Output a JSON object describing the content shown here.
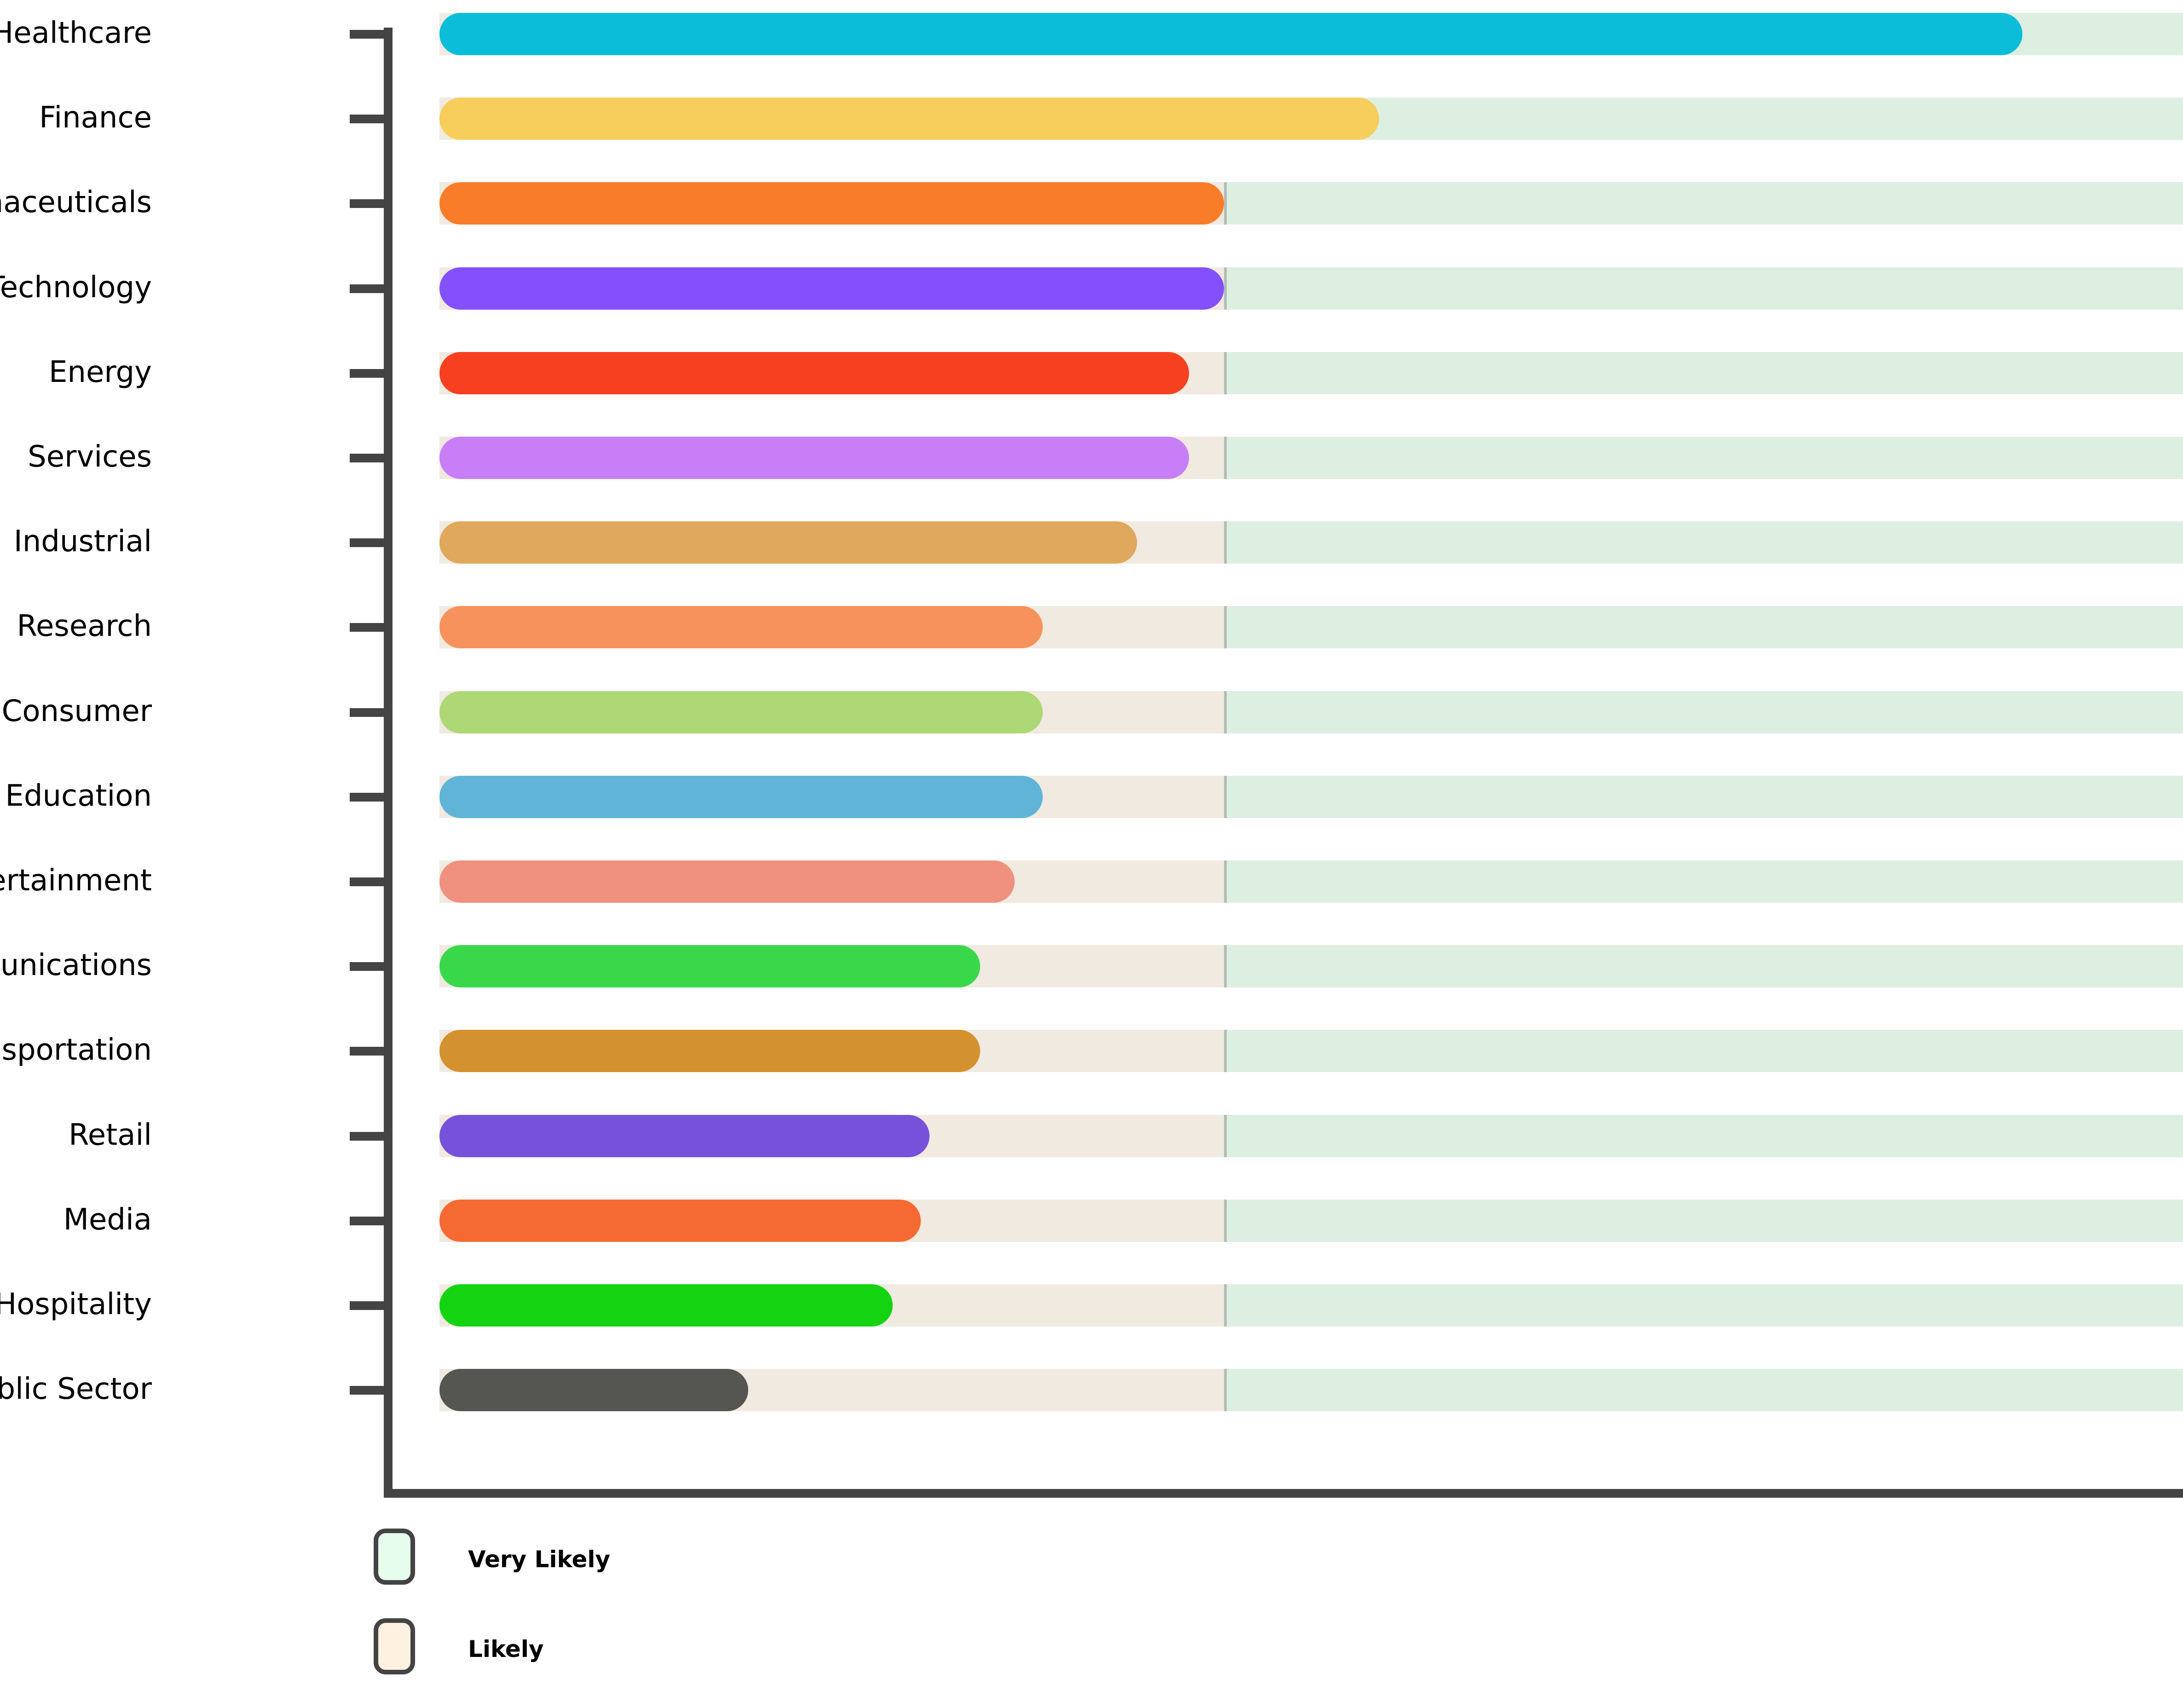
{
  "chart_data": {
    "type": "bar",
    "orientation": "horizontal",
    "title": "",
    "xlabel": "",
    "ylabel": "",
    "grid": false,
    "legend_position": "bottom-left",
    "axis_color": "#444444",
    "xlim": [
      0,
      100
    ],
    "zone_boundary": 45,
    "categories": [
      "Healthcare",
      "Finance",
      "Pharmaceuticals",
      "Technology",
      "Energy",
      "Services",
      "Industrial",
      "Research",
      "Consumer",
      "Education",
      "Entertainment",
      "Communications",
      "Transportation",
      "Retail",
      "Media",
      "Hospitality",
      "Public Sector"
    ],
    "values": [
      90.8,
      53.9,
      45.0,
      45.0,
      43.0,
      43.0,
      40.0,
      34.6,
      34.6,
      34.6,
      33.0,
      31.0,
      31.0,
      28.1,
      27.6,
      26.0,
      17.7
    ],
    "bar_colors": [
      "#0bbdd9",
      "#f7cd5c",
      "#f97d28",
      "#8450fb",
      "#f7401f",
      "#c87ef7",
      "#dfa85c",
      "#f8925c",
      "#aed775",
      "#60b4d8",
      "#f0907e",
      "#39d84a",
      "#d4912f",
      "#7552d9",
      "#f56a32",
      "#14d412",
      "#555552"
    ],
    "zones": [
      {
        "name": "Very Likely",
        "fill": "#e6fcec",
        "fill_alt": "#ddefe1"
      },
      {
        "name": "Likely",
        "fill": "#fdf1e0",
        "fill_alt": "#f0eae0"
      }
    ]
  },
  "legend": {
    "items": [
      {
        "label": "Very Likely",
        "color": "#e6fcec"
      },
      {
        "label": "Likely",
        "color": "#fdf1e0"
      }
    ]
  }
}
